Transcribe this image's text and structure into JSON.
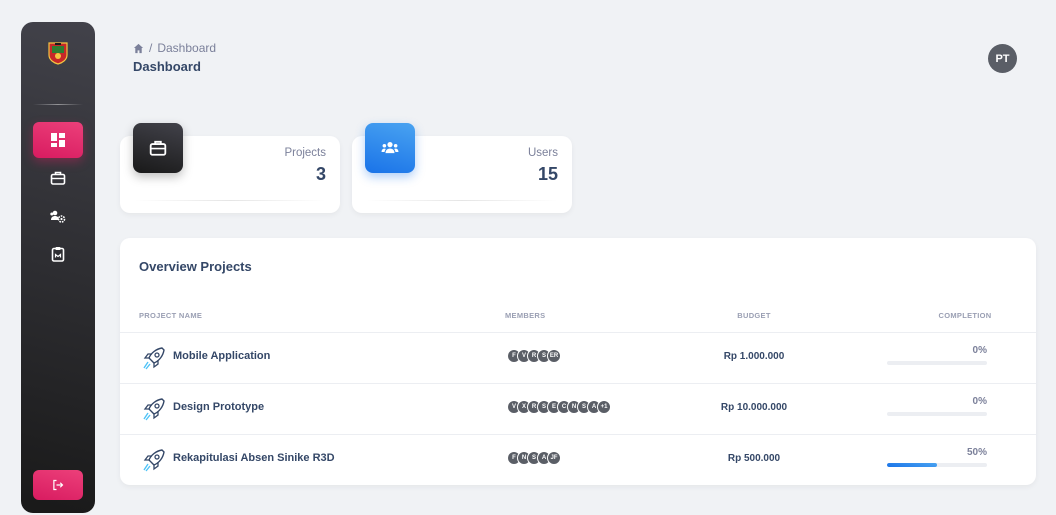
{
  "header": {
    "breadcrumb_current": "Dashboard",
    "page_title": "Dashboard",
    "avatar_initials": "PT"
  },
  "sidebar": {
    "items": [
      {
        "icon": "dashboard-icon",
        "active": true
      },
      {
        "icon": "briefcase-icon",
        "active": false
      },
      {
        "icon": "users-gear-icon",
        "active": false
      },
      {
        "icon": "clipboard-icon",
        "active": false
      }
    ],
    "logout_icon": "logout-icon"
  },
  "stats": [
    {
      "label": "Projects",
      "value": "3",
      "icon": "briefcase-icon"
    },
    {
      "label": "Users",
      "value": "15",
      "icon": "users-icon"
    }
  ],
  "projects": {
    "title": "Overview Projects",
    "columns": [
      "PROJECT NAME",
      "MEMBERS",
      "BUDGET",
      "COMPLETION"
    ],
    "rows": [
      {
        "name": "Mobile Application",
        "members": [
          "F",
          "V",
          "R",
          "S",
          "ER"
        ],
        "budget": "Rp 1.000.000",
        "completion": "0%",
        "progress": 0
      },
      {
        "name": "Design Prototype",
        "members": [
          "V",
          "X",
          "R",
          "S",
          "E",
          "C",
          "N",
          "S",
          "A",
          "+1"
        ],
        "budget": "Rp 10.000.000",
        "completion": "0%",
        "progress": 0
      },
      {
        "name": "Rekapitulasi Absen Sinike R3D",
        "members": [
          "F",
          "N",
          "S",
          "A",
          "JF"
        ],
        "budget": "Rp 500.000",
        "completion": "50%",
        "progress": 0.5
      }
    ]
  },
  "colors": {
    "accent": "#e91e63",
    "info": "#1a73e8",
    "dark": "#344767"
  }
}
